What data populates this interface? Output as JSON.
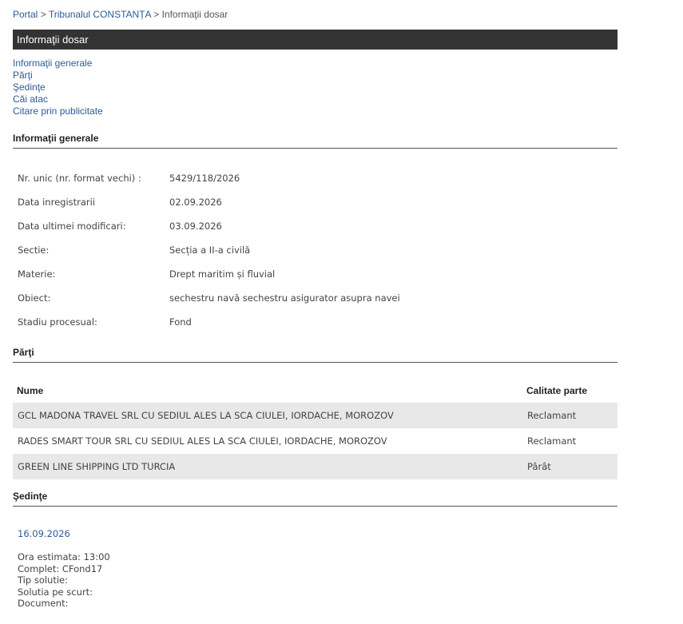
{
  "breadcrumb": {
    "portal": "Portal",
    "sep1": ">",
    "court": "Tribunalul CONSTANȚA",
    "sep2": ">",
    "current": "Informaţii dosar"
  },
  "title": "Informaţii dosar",
  "nav": [
    "Informaţii generale",
    "Părţi",
    "Şedinţe",
    "Căi atac",
    "Citare prin publicitate"
  ],
  "general": {
    "heading": "Informaţii generale",
    "rows": [
      {
        "label": "Nr. unic (nr. format vechi) :",
        "value": "5429/118/2026"
      },
      {
        "label": "Data inregistrarii",
        "value": "02.09.2026"
      },
      {
        "label": "Data ultimei modificari:",
        "value": "03.09.2026"
      },
      {
        "label": "Sectie:",
        "value": "Secția a II-a civilă"
      },
      {
        "label": "Materie:",
        "value": "Drept maritim și fluvial"
      },
      {
        "label": "Obiect:",
        "value": "sechestru navă sechestru asigurator asupra navei"
      },
      {
        "label": "Stadiu procesual:",
        "value": "Fond"
      }
    ]
  },
  "parties": {
    "heading": "Părţi",
    "col_name": "Nume",
    "col_role": "Calitate parte",
    "rows": [
      {
        "name": "GCL MADONA TRAVEL SRL CU SEDIUL ALES LA SCA CIULEI, IORDACHE, MOROZOV",
        "role": "Reclamant"
      },
      {
        "name": "RADES SMART TOUR SRL CU SEDIUL ALES LA SCA CIULEI, IORDACHE, MOROZOV",
        "role": "Reclamant"
      },
      {
        "name": "GREEN LINE SHIPPING LTD TURCIA",
        "role": "Pârât"
      }
    ]
  },
  "hearings": {
    "heading": "Şedinţe",
    "date": "16.09.2026",
    "details": [
      "Ora estimata: 13:00",
      "Complet: CFond17",
      "Tip solutie:",
      "Solutia pe scurt:",
      "Document:"
    ]
  }
}
